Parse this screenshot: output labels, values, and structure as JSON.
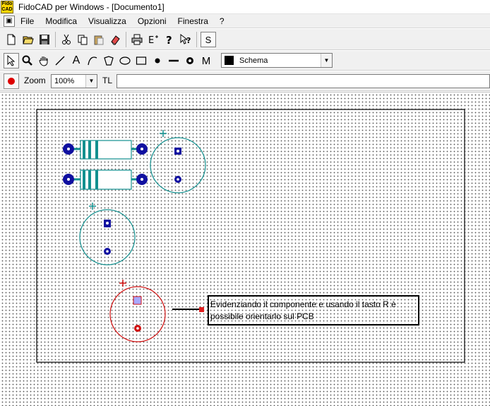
{
  "window": {
    "title": "FidoCAD per Windows - [Documento1]",
    "logo_text": "Fido CAD"
  },
  "menu": {
    "items": [
      "File",
      "Modifica",
      "Visualizza",
      "Opzioni",
      "Finestra",
      "?"
    ]
  },
  "toolbar": {
    "font_button": "S"
  },
  "tools": {
    "text_tool": "A",
    "macro_tool": "M"
  },
  "layer": {
    "selected": "Schema",
    "color": "#000000"
  },
  "zoom": {
    "label": "Zoom",
    "value": "100%"
  },
  "tl": {
    "label": "TL",
    "value": ""
  },
  "canvas": {
    "note": "Evidenziando il componente e usando il tasto R è possibile orientarlo sul PCB",
    "colors": {
      "component": "#12908f",
      "pad": "#1010a0",
      "highlight": "#d01010"
    }
  }
}
